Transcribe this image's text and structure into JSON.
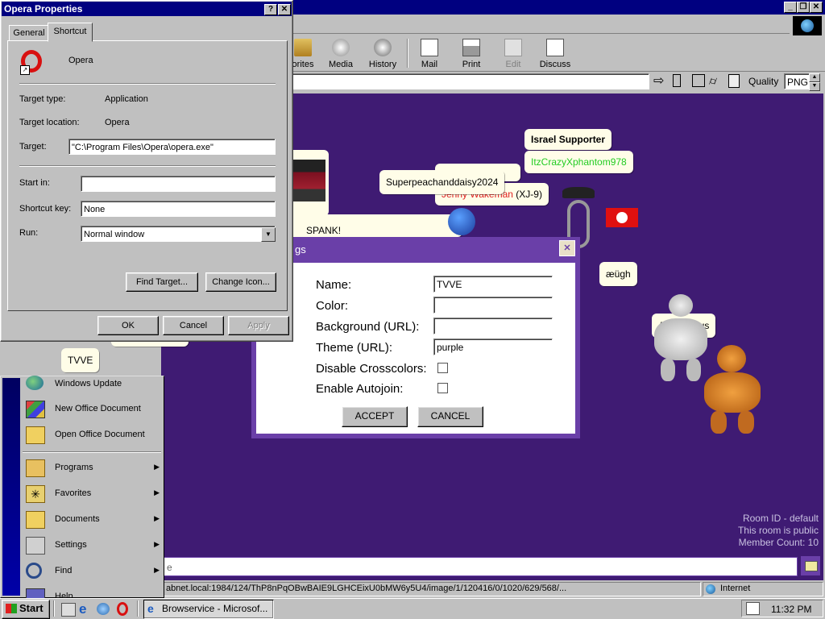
{
  "browser": {
    "toolbar": [
      {
        "label": "orites"
      },
      {
        "label": "Media"
      },
      {
        "label": "History"
      },
      {
        "label": "Mail"
      },
      {
        "label": "Print"
      },
      {
        "label": "Edit"
      },
      {
        "label": "Discuss"
      }
    ],
    "quality_label": "Quality",
    "quality_value": "PNG",
    "status_url": "abnet.local:1984/124/ThP8nPqOBwBAIE9LGHCEixU0bMW6y5U4/image/1/120416/0/1020/629/568/...",
    "status_zone": "Internet"
  },
  "opera_props": {
    "title": "Opera Properties",
    "tabs": [
      "General",
      "Shortcut"
    ],
    "app_name": "Opera",
    "target_type_label": "Target type:",
    "target_type_value": "Application",
    "target_location_label": "Target location:",
    "target_location_value": "Opera",
    "target_label": "Target:",
    "target_value": "\"C:\\Program Files\\Opera\\opera.exe\"",
    "start_in_label": "Start in:",
    "start_in_value": "",
    "shortcut_key_label": "Shortcut key:",
    "shortcut_key_value": "None",
    "run_label": "Run:",
    "run_value": "Normal window",
    "find_target": "Find Target...",
    "change_icon": "Change Icon...",
    "ok": "OK",
    "cancel": "Cancel",
    "apply": "Apply"
  },
  "chat": {
    "bubbles": {
      "israel": "Israel Supporter",
      "itz": "ItzCrazyXphantom978",
      "super": "Superpeachanddaisy2024",
      "jenny_name": "Jenny Wakeman",
      "jenny_tag": "(XJ-9)",
      "spank": "SPANK!",
      "aeugh": "æügh",
      "anon": "Anonymous",
      "tvve": "TVVE"
    },
    "room_info": [
      "Room ID - default",
      "This room is public",
      "Member Count: 10"
    ],
    "input_placeholder": "e",
    "colors": {
      "bg": "#3f1b73",
      "dialog_border": "#6a3fa8",
      "green_name": "#22cc22",
      "red_name": "#e02020"
    }
  },
  "settings": {
    "title": "gs",
    "name_label": "Name:",
    "name_value": "TVVE",
    "color_label": "Color:",
    "color_value": "",
    "bg_label": "Background (URL):",
    "bg_value": "",
    "theme_label": "Theme (URL):",
    "theme_value": "purple",
    "crosscolors_label": "Disable Crosscolors:",
    "autojoin_label": "Enable Autojoin:",
    "accept": "ACCEPT",
    "cancel": "CANCEL"
  },
  "start_menu": {
    "items": [
      {
        "label": "Windows Update",
        "icon": "globe-icon"
      },
      {
        "label": "New Office Document",
        "icon": "office-doc-icon"
      },
      {
        "label": "Open Office Document",
        "icon": "folder-open-icon"
      },
      {
        "label": "Programs",
        "icon": "programs-icon"
      },
      {
        "label": "Favorites",
        "icon": "star-icon"
      },
      {
        "label": "Documents",
        "icon": "documents-icon"
      },
      {
        "label": "Settings",
        "icon": "settings-icon"
      },
      {
        "label": "Find",
        "icon": "find-icon"
      },
      {
        "label": "Help",
        "icon": "help-icon"
      }
    ]
  },
  "taskbar": {
    "start": "Start",
    "task": "Browservice - Microsof...",
    "time": "11:32 PM"
  }
}
